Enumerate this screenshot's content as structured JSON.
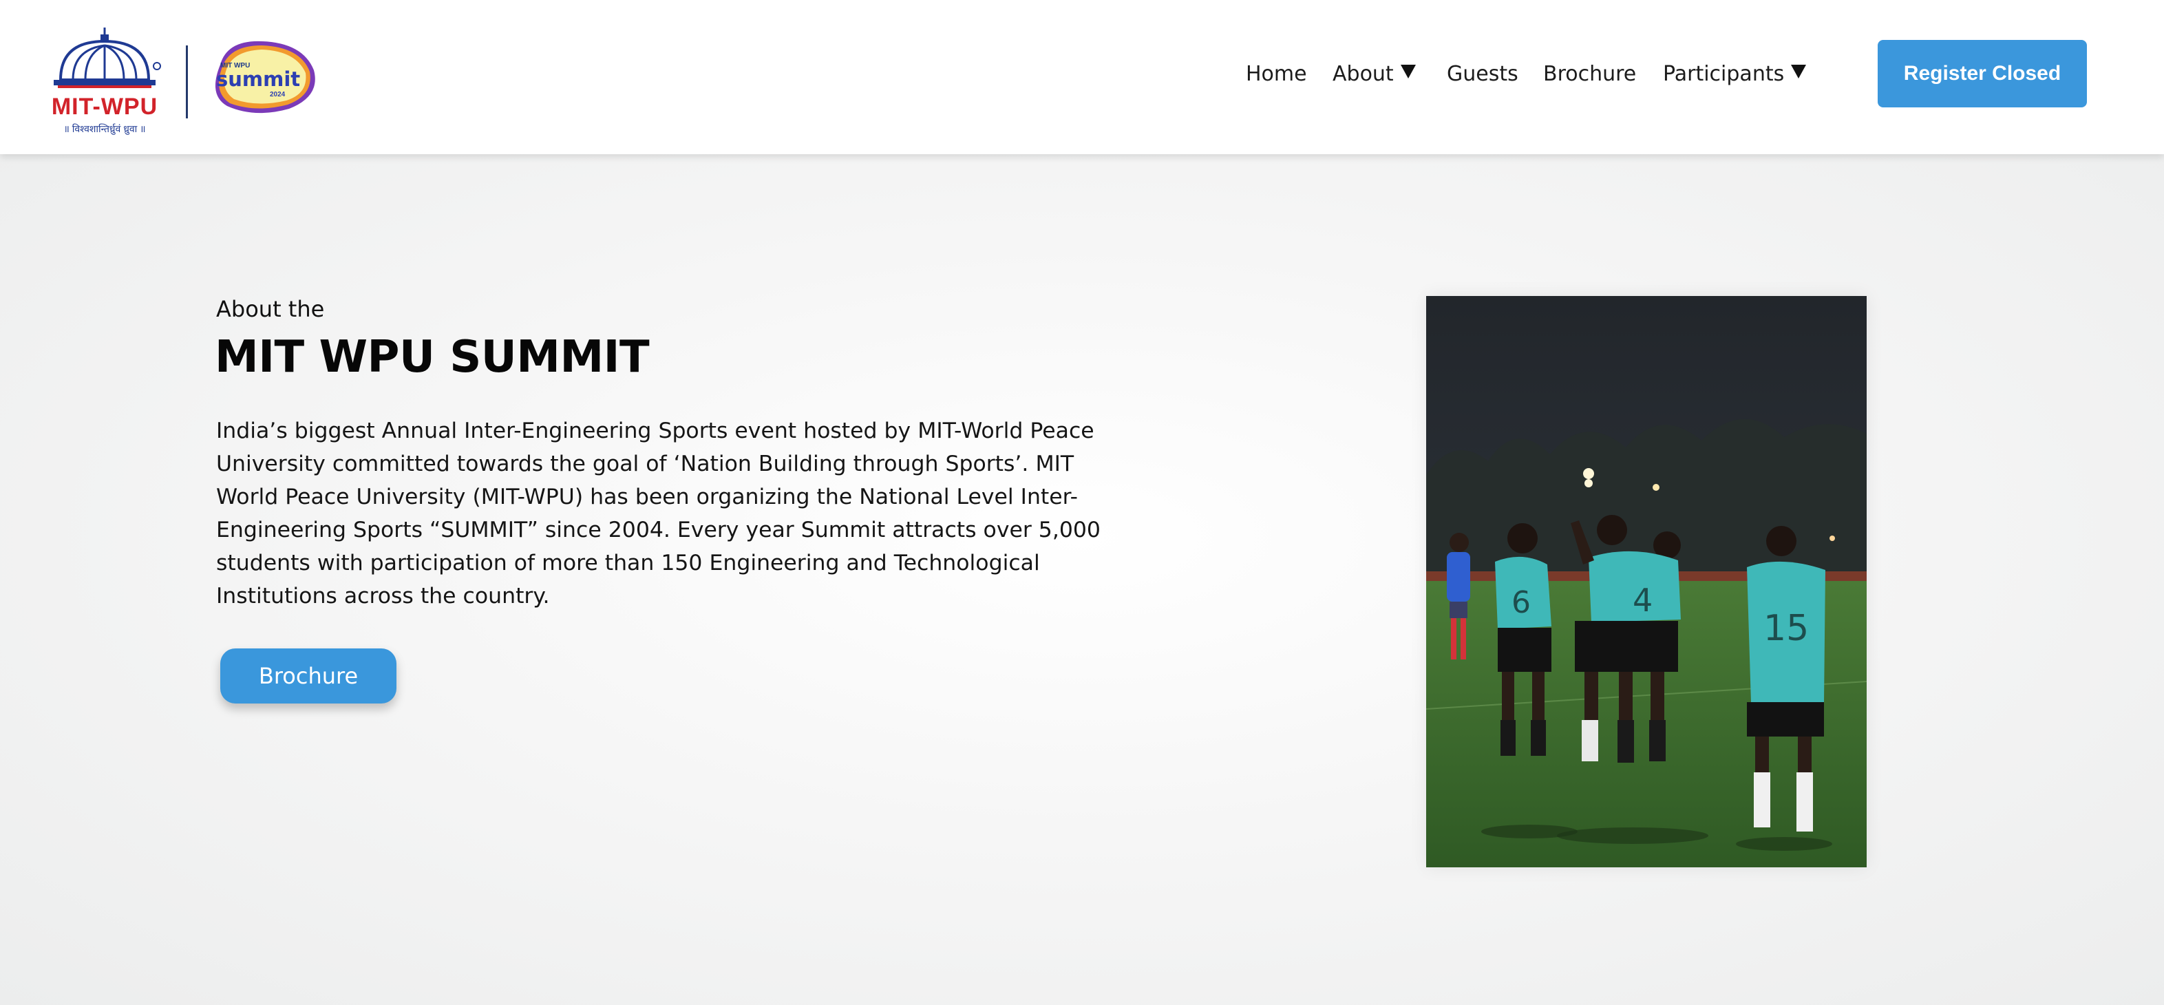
{
  "header": {
    "logo_wpu_text": "MIT-WPU",
    "logo_wpu_tagline": "॥ विश्वशान्तिर्ध्रुवं ध्रुवा ॥",
    "logo_summit_small": "MIT WPU",
    "logo_summit_text": "summit",
    "logo_summit_year": "2024",
    "nav": {
      "home": "Home",
      "about": "About",
      "guests": "Guests",
      "brochure": "Brochure",
      "participants": "Participants"
    },
    "register_label": "Register Closed"
  },
  "about": {
    "kicker": "About the",
    "title": "MIT WPU SUMMIT",
    "paragraph": "India’s biggest Annual Inter-Engineering Sports event hosted by MIT-World Peace University committed towards the goal of ‘Nation Building through Sports’. MIT World Peace University (MIT-WPU) has been organizing the National Level Inter-Engineering Sports “SUMMIT” since 2004. Every year Summit attracts over 5,000 students with participation of more than 150 Engineering and Technological Institutions across the country.",
    "brochure_label": "Brochure",
    "photo_jersey_numbers": [
      "6",
      "4",
      "15"
    ]
  },
  "colors": {
    "accent": "#3b97dc",
    "brand_red": "#d2232a",
    "brand_blue": "#1f3a93",
    "jersey": "#3fb8b8"
  }
}
